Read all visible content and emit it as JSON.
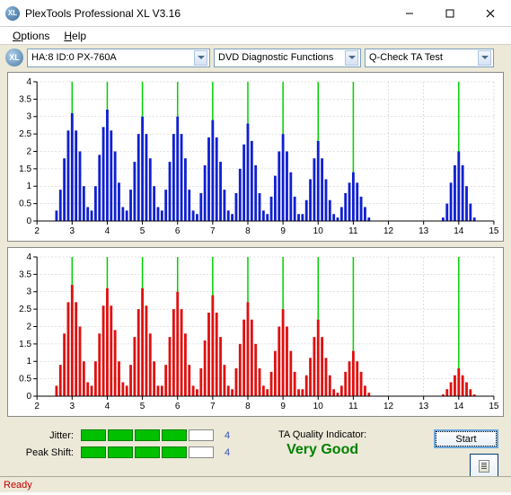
{
  "window": {
    "title": "PlexTools Professional XL V3.16",
    "icon_text": "XL"
  },
  "menu": {
    "options": "Options",
    "help": "Help"
  },
  "toolbar": {
    "drive_icon_text": "XL",
    "drive_dropdown": "HA:8 ID:0   PX-760A",
    "function_dropdown": "DVD Diagnostic Functions",
    "test_dropdown": "Q-Check TA Test"
  },
  "chart_data": [
    {
      "type": "bar",
      "color": "#1020d0",
      "xrange": [
        2,
        15
      ],
      "xticks": [
        2,
        3,
        4,
        5,
        6,
        7,
        8,
        9,
        10,
        11,
        12,
        13,
        14,
        15
      ],
      "ylim": [
        0,
        4
      ],
      "yticks": [
        0,
        0.5,
        1,
        1.5,
        2,
        2.5,
        3,
        3.5,
        4
      ],
      "green_lines": [
        3,
        4,
        5,
        6,
        7,
        8,
        9,
        10,
        11,
        14
      ],
      "clusters": [
        {
          "center": 3,
          "peak": 3.1,
          "bars": [
            0.3,
            0.9,
            1.8,
            2.6,
            3.1,
            2.6,
            2.0,
            1.0,
            0.4
          ]
        },
        {
          "center": 4,
          "peak": 3.2,
          "bars": [
            0.3,
            1.0,
            1.9,
            2.7,
            3.2,
            2.6,
            2.0,
            1.1,
            0.4
          ]
        },
        {
          "center": 5,
          "peak": 3.0,
          "bars": [
            0.3,
            0.9,
            1.7,
            2.5,
            3.0,
            2.5,
            1.8,
            1.0,
            0.4
          ]
        },
        {
          "center": 6,
          "peak": 3.0,
          "bars": [
            0.3,
            0.9,
            1.7,
            2.5,
            3.0,
            2.5,
            1.8,
            0.9,
            0.3
          ]
        },
        {
          "center": 7,
          "peak": 2.9,
          "bars": [
            0.2,
            0.8,
            1.6,
            2.4,
            2.9,
            2.4,
            1.7,
            0.9,
            0.3
          ]
        },
        {
          "center": 8,
          "peak": 2.8,
          "bars": [
            0.2,
            0.8,
            1.5,
            2.2,
            2.8,
            2.3,
            1.6,
            0.8,
            0.3
          ]
        },
        {
          "center": 9,
          "peak": 2.5,
          "bars": [
            0.2,
            0.7,
            1.3,
            2.0,
            2.5,
            2.0,
            1.4,
            0.7,
            0.2
          ]
        },
        {
          "center": 10,
          "peak": 2.3,
          "bars": [
            0.2,
            0.6,
            1.2,
            1.8,
            2.3,
            1.8,
            1.2,
            0.6,
            0.2
          ]
        },
        {
          "center": 11,
          "peak": 1.4,
          "bars": [
            0.1,
            0.4,
            0.8,
            1.1,
            1.4,
            1.1,
            0.7,
            0.4,
            0.1
          ]
        },
        {
          "center": 14,
          "peak": 2.0,
          "bars": [
            0.1,
            0.5,
            1.1,
            1.6,
            2.0,
            1.6,
            1.0,
            0.5,
            0.1
          ]
        }
      ]
    },
    {
      "type": "bar",
      "color": "#e01010",
      "xrange": [
        2,
        15
      ],
      "xticks": [
        2,
        3,
        4,
        5,
        6,
        7,
        8,
        9,
        10,
        11,
        12,
        13,
        14,
        15
      ],
      "ylim": [
        0,
        4
      ],
      "yticks": [
        0,
        0.5,
        1,
        1.5,
        2,
        2.5,
        3,
        3.5,
        4
      ],
      "green_lines": [
        3,
        4,
        5,
        6,
        7,
        8,
        9,
        10,
        11,
        14
      ],
      "clusters": [
        {
          "center": 3,
          "peak": 3.2,
          "bars": [
            0.3,
            0.9,
            1.8,
            2.7,
            3.2,
            2.7,
            2.0,
            1.0,
            0.4
          ]
        },
        {
          "center": 4,
          "peak": 3.1,
          "bars": [
            0.3,
            1.0,
            1.8,
            2.6,
            3.1,
            2.6,
            1.9,
            1.0,
            0.4
          ]
        },
        {
          "center": 5,
          "peak": 3.1,
          "bars": [
            0.3,
            0.9,
            1.7,
            2.5,
            3.1,
            2.6,
            1.8,
            1.0,
            0.3
          ]
        },
        {
          "center": 6,
          "peak": 3.0,
          "bars": [
            0.3,
            0.9,
            1.7,
            2.5,
            3.0,
            2.5,
            1.8,
            0.9,
            0.3
          ]
        },
        {
          "center": 7,
          "peak": 2.9,
          "bars": [
            0.2,
            0.8,
            1.6,
            2.4,
            2.9,
            2.4,
            1.7,
            0.9,
            0.3
          ]
        },
        {
          "center": 8,
          "peak": 2.7,
          "bars": [
            0.2,
            0.8,
            1.5,
            2.2,
            2.7,
            2.2,
            1.5,
            0.8,
            0.3
          ]
        },
        {
          "center": 9,
          "peak": 2.5,
          "bars": [
            0.2,
            0.7,
            1.3,
            2.0,
            2.5,
            2.0,
            1.3,
            0.7,
            0.2
          ]
        },
        {
          "center": 10,
          "peak": 2.2,
          "bars": [
            0.2,
            0.6,
            1.1,
            1.7,
            2.2,
            1.7,
            1.1,
            0.6,
            0.2
          ]
        },
        {
          "center": 11,
          "peak": 1.3,
          "bars": [
            0.1,
            0.3,
            0.7,
            1.0,
            1.3,
            1.0,
            0.7,
            0.3,
            0.1
          ]
        },
        {
          "center": 14,
          "peak": 0.8,
          "bars": [
            0.05,
            0.2,
            0.4,
            0.6,
            0.8,
            0.6,
            0.4,
            0.2,
            0.05
          ]
        }
      ]
    }
  ],
  "meters": {
    "jitter": {
      "label": "Jitter:",
      "filled": 4,
      "total": 5,
      "value": "4"
    },
    "peak_shift": {
      "label": "Peak Shift:",
      "filled": 4,
      "total": 5,
      "value": "4"
    }
  },
  "quality": {
    "label": "TA Quality Indicator:",
    "value": "Very Good"
  },
  "buttons": {
    "start": "Start"
  },
  "status": {
    "text": "Ready"
  }
}
